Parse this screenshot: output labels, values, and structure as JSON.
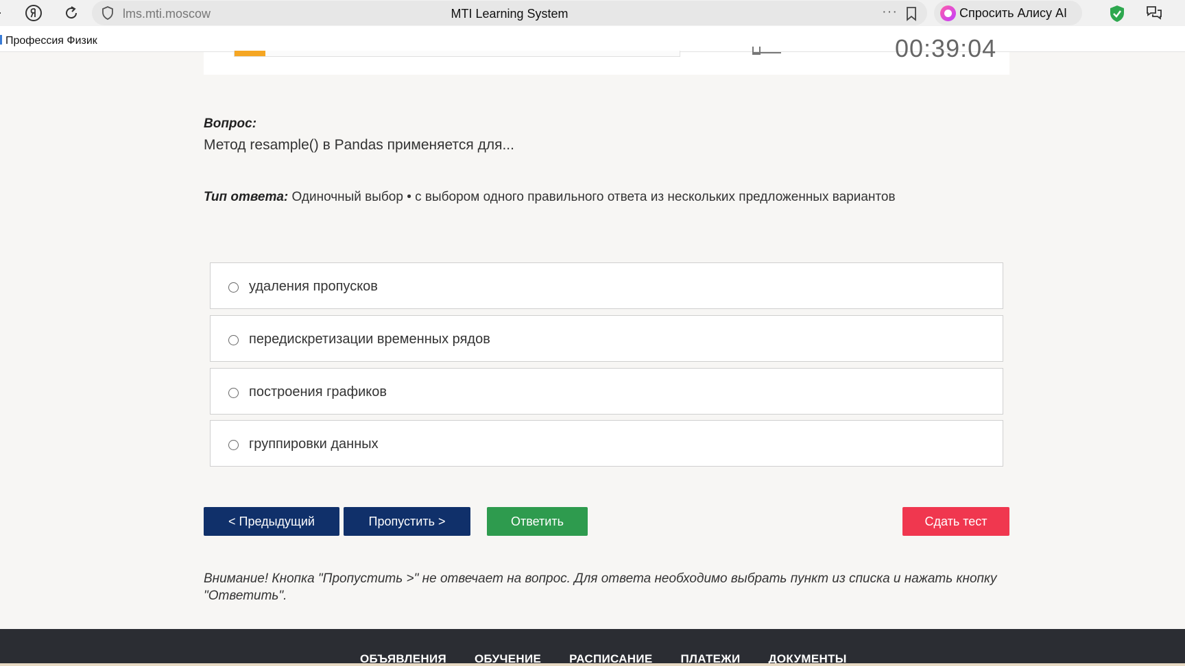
{
  "browser": {
    "url": "lms.mti.moscow",
    "title": "MTI Learning System",
    "alice_label": "Спросить Алису AI",
    "bookmark": "Профессия Физик",
    "more_dots": "···"
  },
  "progress": {
    "fraction": 0.07,
    "timer": "00:39:04"
  },
  "question": {
    "label": "Вопрос:",
    "text": "Метод resample() в Pandas применяется для...",
    "type_label": "Тип ответа:",
    "type_text": "Одиночный выбор • с выбором одного правильного ответа из нескольких предложенных вариантов"
  },
  "options": [
    {
      "label": "удаления пропусков"
    },
    {
      "label": "передискретизации временных рядов"
    },
    {
      "label": "построения графиков"
    },
    {
      "label": "группировки данных"
    }
  ],
  "buttons": {
    "prev": "< Предыдущий",
    "skip": "Пропустить >",
    "answer": "Ответить",
    "submit": "Сдать тест"
  },
  "warning": "Внимание! Кнопка \"Пропустить >\" не отвечает на вопрос. Для ответа необходимо выбрать пункт из списка и нажать кнопку \"Ответить\".",
  "footer": {
    "nav": [
      "ОБЪЯВЛЕНИЯ",
      "ОБУЧЕНИЕ",
      "РАСПИСАНИЕ",
      "ПЛАТЕЖИ",
      "ДОКУМЕНТЫ"
    ]
  },
  "colors": {
    "primary_button": "#10306a",
    "answer_button": "#2e9b4e",
    "submit_button": "#f0374f",
    "progress": "#f5a623",
    "footer": "#2b2d33"
  }
}
